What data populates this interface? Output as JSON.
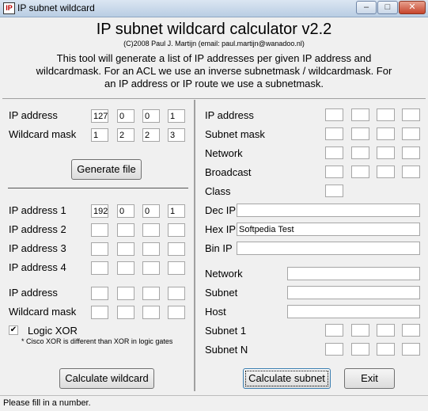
{
  "window": {
    "title": "IP subnet wildcard",
    "icon_text": "IP"
  },
  "controls": {
    "minimize": "–",
    "maximize": "□",
    "close": "✕"
  },
  "header": {
    "title": "IP subnet wildcard calculator v2.2",
    "credit": "(C)2008 Paul J. Martijn (email: paul.martijn@wanadoo.nl)",
    "description": [
      "This tool will generate a list of IP addresses per given IP address and",
      "wildcardmask. For an ACL we use an inverse subnetmask / wildcardmask. For",
      "an IP address or IP route we use a subnetmask."
    ]
  },
  "left": {
    "ip_address_label": "IP address",
    "ip_address": [
      "127",
      "0",
      "0",
      "1"
    ],
    "wildcard_label": "Wildcard mask",
    "wildcard": [
      "1",
      "2",
      "2",
      "3"
    ],
    "generate_label": "Generate file",
    "ip1_label": "IP address 1",
    "ip1": [
      "192",
      "0",
      "0",
      "1"
    ],
    "ip2_label": "IP address 2",
    "ip3_label": "IP address 3",
    "ip4_label": "IP address 4",
    "ip5_label": "IP address",
    "wildcard2_label": "Wildcard mask",
    "xor_label": "Logic XOR",
    "xor_checked": true,
    "xor_check": "✔",
    "xor_note": "* Cisco XOR is different than XOR in logic gates",
    "calc_wildcard_label": "Calculate wildcard"
  },
  "right": {
    "ip_label": "IP address",
    "mask_label": "Subnet mask",
    "network_label": "Network",
    "broadcast_label": "Broadcast",
    "class_label": "Class",
    "dec_label": "Dec IP",
    "dec_value": "",
    "hex_label": "Hex IP",
    "hex_value": "Softpedia Test",
    "bin_label": "Bin IP",
    "bin_value": "",
    "network2_label": "Network",
    "subnet_label": "Subnet",
    "host_label": "Host",
    "subnet1_label": "Subnet 1",
    "subnetn_label": "Subnet N",
    "calc_subnet_label": "Calculate subnet",
    "exit_label": "Exit"
  },
  "status": "Please fill in a number."
}
